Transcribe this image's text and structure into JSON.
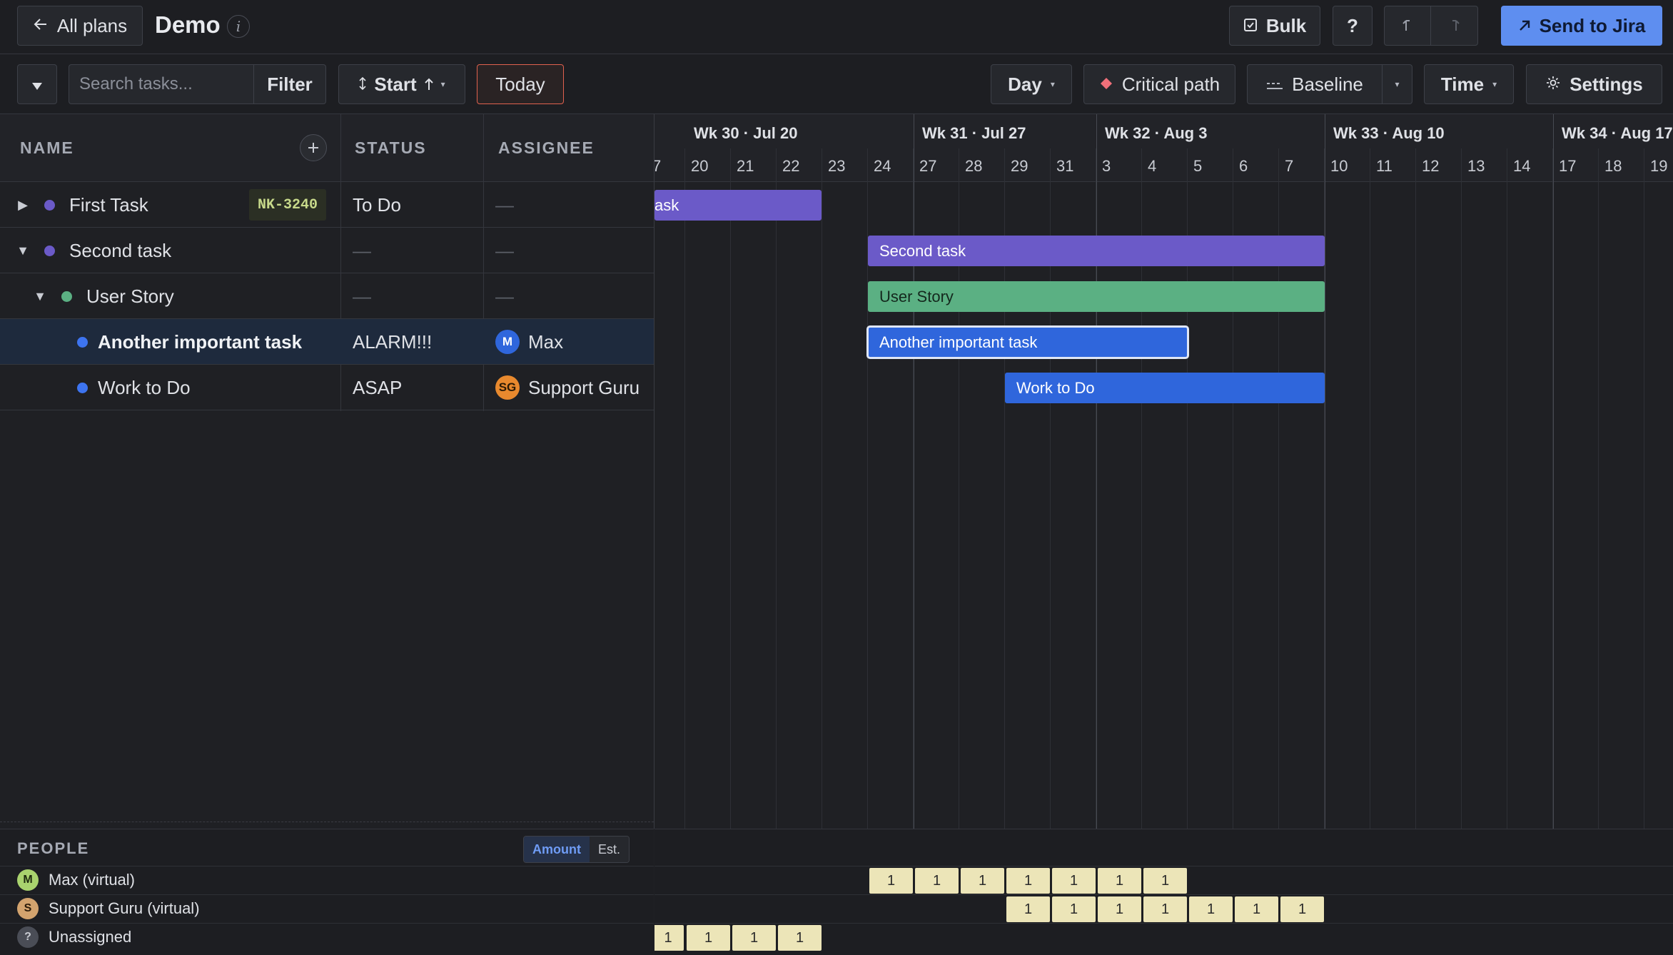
{
  "topbar": {
    "back_label": "All plans",
    "plan_title": "Demo",
    "info_glyph": "i",
    "bulk_label": "Bulk",
    "help_label": "?",
    "send_label": "Send to Jira"
  },
  "toolbar": {
    "search_placeholder": "Search tasks...",
    "filter_label": "Filter",
    "sort_label": "Start",
    "today_label": "Today",
    "day_label": "Day",
    "critical_label": "Critical path",
    "baseline_label": "Baseline",
    "time_label": "Time",
    "settings_label": "Settings"
  },
  "columns": {
    "name": "NAME",
    "status": "STATUS",
    "assignee": "ASSIGNEE"
  },
  "tasks": [
    {
      "name": "First Task",
      "key": "NK-3240",
      "status": "To Do",
      "assignee": "—",
      "dot": "#6b5ac8",
      "toggle": "▶"
    },
    {
      "name": "Second task",
      "status": "—",
      "assignee": "—",
      "dot": "#6b5ac8",
      "toggle": "▼"
    },
    {
      "name": "User Story",
      "status": "—",
      "assignee": "—",
      "dot": "#5bb083",
      "toggle": "▼"
    },
    {
      "name": "Another important task",
      "status": "ALARM!!!",
      "assignee": "Max",
      "avatar": "M",
      "dot": "#3d74f0"
    },
    {
      "name": "Work to Do",
      "status": "ASAP",
      "assignee": "Support Guru",
      "avatar": "SG",
      "dot": "#3d74f0"
    }
  ],
  "timeline": {
    "weeks": [
      "Wk 30 · Jul 20",
      "Wk 31 · Jul 27",
      "Wk 32 · Aug 3",
      "Wk 33 · Aug 10",
      "Wk 34 · Aug 17"
    ],
    "days": [
      "7",
      "20",
      "21",
      "22",
      "23",
      "24",
      "27",
      "28",
      "29",
      "31",
      "3",
      "4",
      "5",
      "6",
      "7",
      "10",
      "11",
      "12",
      "13",
      "14",
      "17",
      "18",
      "19"
    ],
    "bars": [
      {
        "label": "ask",
        "color": "#6b5ac8"
      },
      {
        "label": "Second task",
        "color": "#6b5ac8"
      },
      {
        "label": "User Story",
        "color": "#5bb083"
      },
      {
        "label": "Another important task",
        "color": "#2f66dc"
      },
      {
        "label": "Work to Do",
        "color": "#2f66dc"
      }
    ]
  },
  "people": {
    "title": "PEOPLE",
    "mode_amount": "Amount",
    "mode_est": "Est.",
    "rows": [
      {
        "initial": "M",
        "name": "Max (virtual)",
        "color": "#a9d36e",
        "values": [
          "1",
          "1",
          "1",
          "1",
          "1",
          "1",
          "1"
        ]
      },
      {
        "initial": "S",
        "name": "Support Guru (virtual)",
        "color": "#d3a36e",
        "values": [
          "1",
          "1",
          "1",
          "1",
          "1",
          "1",
          "1"
        ]
      },
      {
        "initial": "?",
        "name": "Unassigned",
        "color": "#4a4d56",
        "values": [
          "1",
          "1",
          "1",
          "1"
        ]
      }
    ]
  },
  "colors": {
    "accent": "#5e8ef0",
    "today_border": "#e0614e",
    "critical": "#f0707a"
  }
}
